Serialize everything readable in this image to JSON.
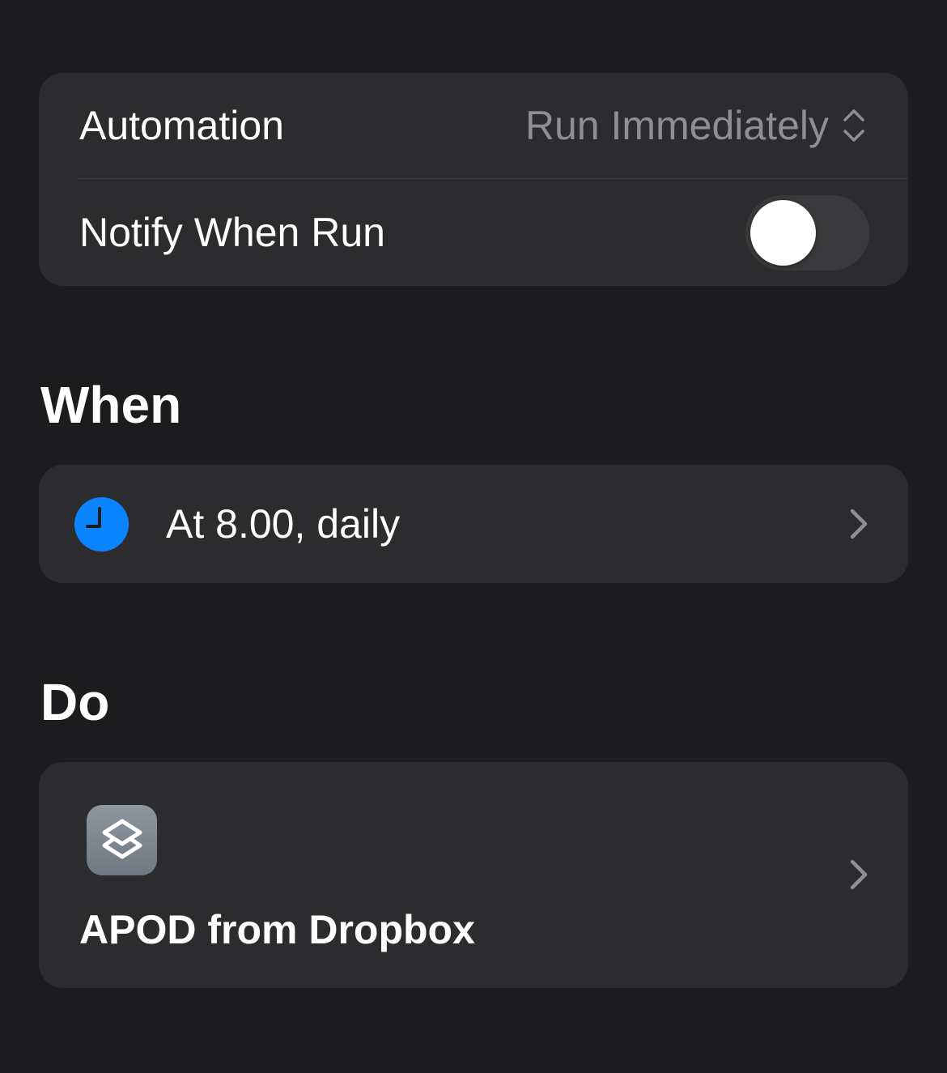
{
  "settings": {
    "automation_label": "Automation",
    "automation_value": "Run Immediately",
    "notify_label": "Notify When Run",
    "notify_enabled": false
  },
  "when": {
    "section_title": "When",
    "trigger_label": "At 8.00, daily",
    "trigger_icon": "clock-icon",
    "icon_color": "#0a84ff"
  },
  "do": {
    "section_title": "Do",
    "shortcut_name": "APOD from Dropbox",
    "shortcut_icon": "shortcuts-icon"
  }
}
